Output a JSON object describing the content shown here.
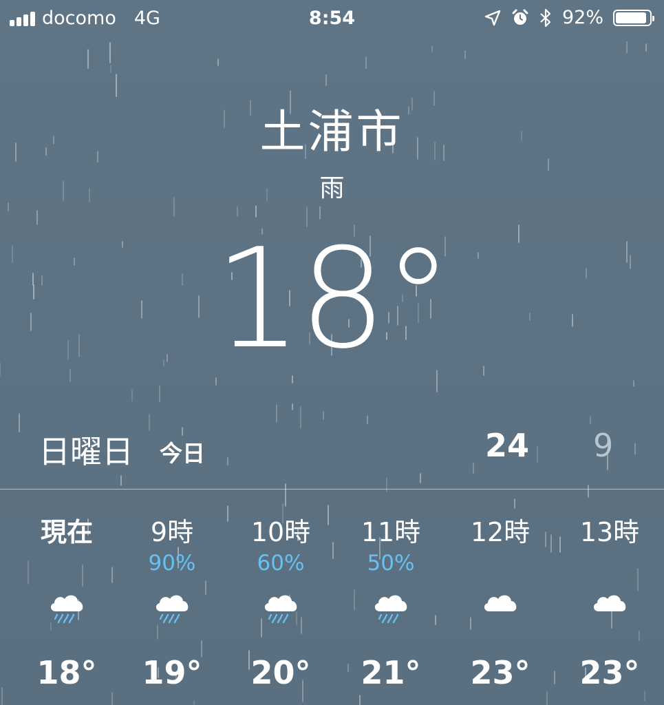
{
  "status_bar": {
    "carrier": "docomo",
    "network": "4G",
    "time": "8:54",
    "battery_percent": "92%",
    "battery_level": 0.92,
    "icons": [
      "location-arrow-icon",
      "alarm-clock-icon",
      "bluetooth-icon"
    ]
  },
  "location": {
    "city": "土浦市",
    "condition": "雨",
    "temperature": "18°"
  },
  "today": {
    "day": "日曜日",
    "label": "今日",
    "high": "24",
    "low": "9"
  },
  "hourly": [
    {
      "time": "現在",
      "pop": "",
      "temp": "18°",
      "icon": "rain-cloud-icon"
    },
    {
      "time": "9時",
      "pop": "90%",
      "temp": "19°",
      "icon": "rain-cloud-icon"
    },
    {
      "time": "10時",
      "pop": "60%",
      "temp": "20°",
      "icon": "rain-cloud-icon"
    },
    {
      "time": "11時",
      "pop": "50%",
      "temp": "21°",
      "icon": "rain-cloud-icon"
    },
    {
      "time": "12時",
      "pop": "",
      "temp": "23°",
      "icon": "cloud-icon"
    },
    {
      "time": "13時",
      "pop": "",
      "temp": "23°",
      "icon": "cloud-icon"
    }
  ],
  "colors": {
    "background": "#5d7282",
    "precipitation": "#66c1f3",
    "low_temp": "#b9c5ce"
  }
}
